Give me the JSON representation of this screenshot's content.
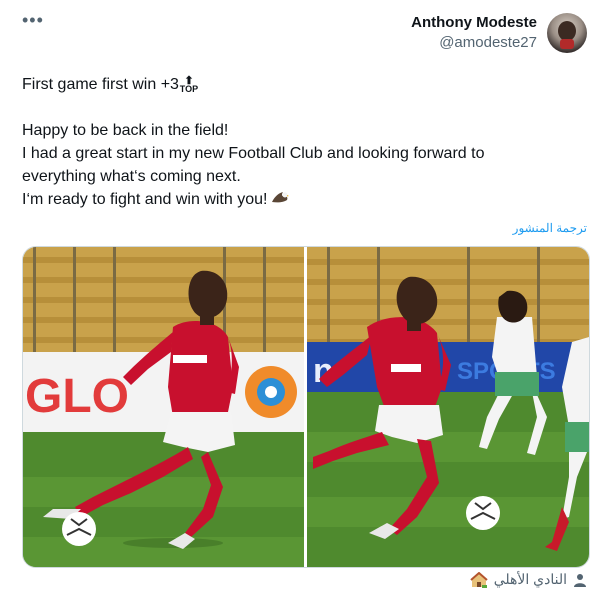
{
  "menu": {
    "more_label": "•••"
  },
  "author": {
    "name": "Anthony Modeste",
    "handle": "@amodeste27"
  },
  "tweet": {
    "line1": "First game first win +3",
    "top_emoji_text": "TOP",
    "line2": "Happy to be back in the field!",
    "line3": "I had a great start in my new Football Club and looking forward to",
    "line4": "everything what‘s coming next.",
    "line5": "I‘m ready to fight and win with you!"
  },
  "translate_label": "ترجمة المنشور",
  "footer": {
    "tag_label": "النادي الأهلي"
  },
  "colors": {
    "accent": "#1d9bf0",
    "text": "#0f1419",
    "muted": "#536471",
    "jersey": "#c8102e",
    "pitch": "#4f8a2e"
  },
  "icons": [
    "more-icon",
    "top-arrow-emoji",
    "eagle-emoji",
    "user-icon",
    "house-emoji"
  ]
}
